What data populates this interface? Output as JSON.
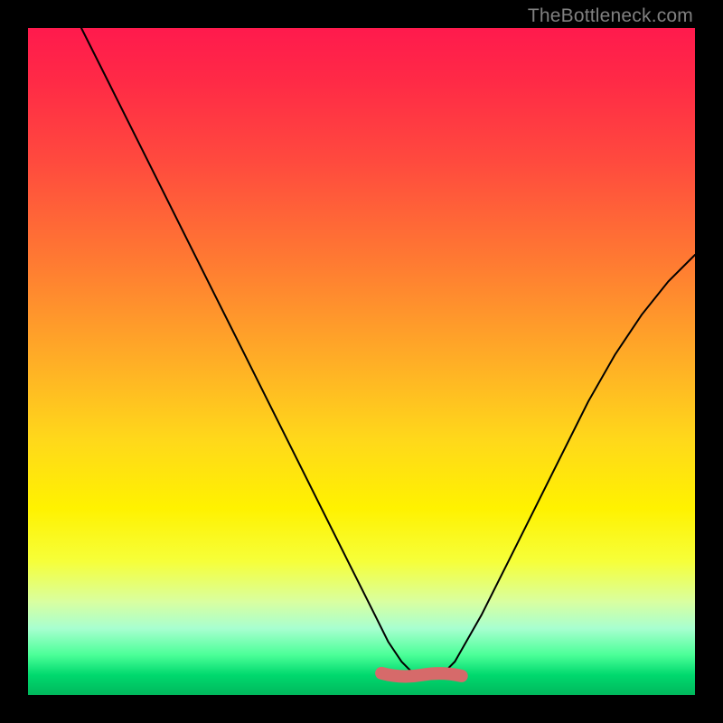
{
  "watermark": "TheBottleneck.com",
  "chart_data": {
    "type": "line",
    "title": "",
    "xlabel": "",
    "ylabel": "",
    "xlim": [
      0,
      100
    ],
    "ylim": [
      0,
      100
    ],
    "series": [
      {
        "name": "bottleneck-curve",
        "x": [
          8,
          12,
          16,
          20,
          24,
          28,
          32,
          36,
          40,
          44,
          48,
          52,
          54,
          56,
          58,
          60,
          62,
          64,
          68,
          72,
          76,
          80,
          84,
          88,
          92,
          96,
          100
        ],
        "y": [
          100,
          92,
          84,
          76,
          68,
          60,
          52,
          44,
          36,
          28,
          20,
          12,
          8,
          5,
          3,
          3,
          3,
          5,
          12,
          20,
          28,
          36,
          44,
          51,
          57,
          62,
          66
        ]
      }
    ],
    "highlight": {
      "name": "minimum-band",
      "x": [
        53,
        65
      ],
      "y": [
        3,
        3
      ],
      "color": "#d66a6a"
    },
    "gradient_stops": [
      {
        "pos": 0.0,
        "color": "#ff1a4d"
      },
      {
        "pos": 0.35,
        "color": "#ff7a32"
      },
      {
        "pos": 0.62,
        "color": "#ffd91a"
      },
      {
        "pos": 0.8,
        "color": "#f6ff3a"
      },
      {
        "pos": 0.94,
        "color": "#4bff98"
      },
      {
        "pos": 1.0,
        "color": "#00b85c"
      }
    ]
  }
}
